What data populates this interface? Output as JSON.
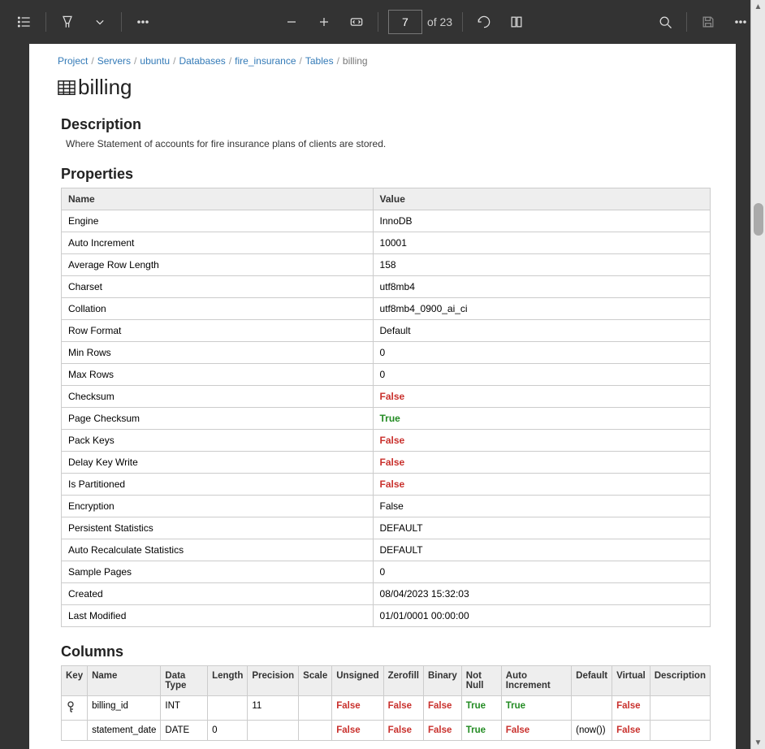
{
  "toolbar": {
    "page_current": "7",
    "page_total": "of 23"
  },
  "breadcrumbs": [
    {
      "label": "Project",
      "link": true
    },
    {
      "label": "Servers",
      "link": true
    },
    {
      "label": "ubuntu",
      "link": true
    },
    {
      "label": "Databases",
      "link": true
    },
    {
      "label": "fire_insurance",
      "link": true
    },
    {
      "label": "Tables",
      "link": true
    },
    {
      "label": "billing",
      "link": false
    }
  ],
  "title": "billing",
  "sections": {
    "description_heading": "Description",
    "description_text": "Where Statement of accounts for fire insurance plans of clients are stored.",
    "properties_heading": "Properties",
    "columns_heading": "Columns"
  },
  "properties": {
    "headers": {
      "name": "Name",
      "value": "Value"
    },
    "rows": [
      {
        "name": "Engine",
        "value": "InnoDB",
        "style": ""
      },
      {
        "name": "Auto Increment",
        "value": "10001",
        "style": ""
      },
      {
        "name": "Average Row Length",
        "value": "158",
        "style": ""
      },
      {
        "name": "Charset",
        "value": "utf8mb4",
        "style": ""
      },
      {
        "name": "Collation",
        "value": "utf8mb4_0900_ai_ci",
        "style": ""
      },
      {
        "name": "Row Format",
        "value": "Default",
        "style": ""
      },
      {
        "name": "Min Rows",
        "value": "0",
        "style": ""
      },
      {
        "name": "Max Rows",
        "value": "0",
        "style": ""
      },
      {
        "name": "Checksum",
        "value": "False",
        "style": "false"
      },
      {
        "name": "Page Checksum",
        "value": "True",
        "style": "true"
      },
      {
        "name": "Pack Keys",
        "value": "False",
        "style": "false"
      },
      {
        "name": "Delay Key Write",
        "value": "False",
        "style": "false"
      },
      {
        "name": "Is Partitioned",
        "value": "False",
        "style": "false"
      },
      {
        "name": "Encryption",
        "value": "False",
        "style": ""
      },
      {
        "name": "Persistent Statistics",
        "value": "DEFAULT",
        "style": ""
      },
      {
        "name": "Auto Recalculate Statistics",
        "value": "DEFAULT",
        "style": ""
      },
      {
        "name": "Sample Pages",
        "value": "0",
        "style": ""
      },
      {
        "name": "Created",
        "value": "08/04/2023 15:32:03",
        "style": ""
      },
      {
        "name": "Last Modified",
        "value": "01/01/0001 00:00:00",
        "style": ""
      }
    ]
  },
  "columns": {
    "headers": [
      "Key",
      "Name",
      "Data Type",
      "Length",
      "Precision",
      "Scale",
      "Unsigned",
      "Zerofill",
      "Binary",
      "Not Null",
      "Auto Increment",
      "Default",
      "Virtual",
      "Description"
    ],
    "rows": [
      {
        "key": true,
        "name": "billing_id",
        "datatype": "INT",
        "length": "",
        "precision": "11",
        "scale": "",
        "unsigned": "False",
        "zerofill": "False",
        "binary": "False",
        "notnull": "True",
        "autoinc": "True",
        "default": "",
        "virtual": "False",
        "description": ""
      },
      {
        "key": false,
        "name": "statement_date",
        "datatype": "DATE",
        "length": "0",
        "precision": "",
        "scale": "",
        "unsigned": "False",
        "zerofill": "False",
        "binary": "False",
        "notnull": "True",
        "autoinc": "False",
        "default": "(now())",
        "virtual": "False",
        "description": ""
      }
    ]
  }
}
